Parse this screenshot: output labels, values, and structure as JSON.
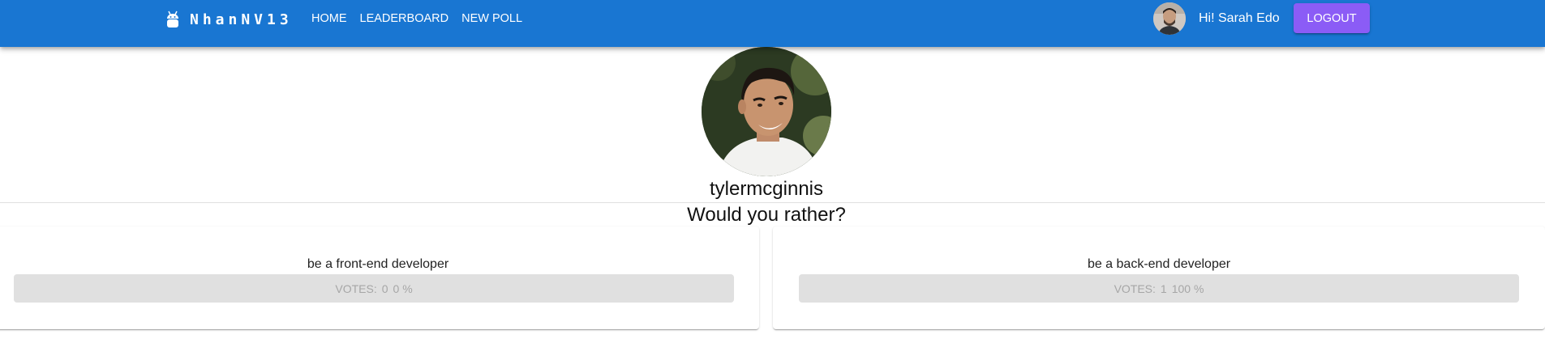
{
  "appbar": {
    "brand": "NhanNV13",
    "brand_icon": "android-icon",
    "nav": [
      {
        "label": "Home"
      },
      {
        "label": "Leaderboard"
      },
      {
        "label": "New Poll"
      }
    ],
    "greeting": "Hi! Sarah Edo",
    "logout_label": "Logout",
    "colors": {
      "bar": "#1976d2",
      "logout": "#8b5cf6"
    }
  },
  "poll": {
    "author": "tylermcginnis",
    "question": "Would you rather?",
    "options": [
      {
        "text": "be a front-end developer",
        "votes_label": "Votes:",
        "votes": "0",
        "percent": "0 %"
      },
      {
        "text": "be a back-end developer",
        "votes_label": "Votes:",
        "votes": "1",
        "percent": "100 %"
      }
    ]
  }
}
